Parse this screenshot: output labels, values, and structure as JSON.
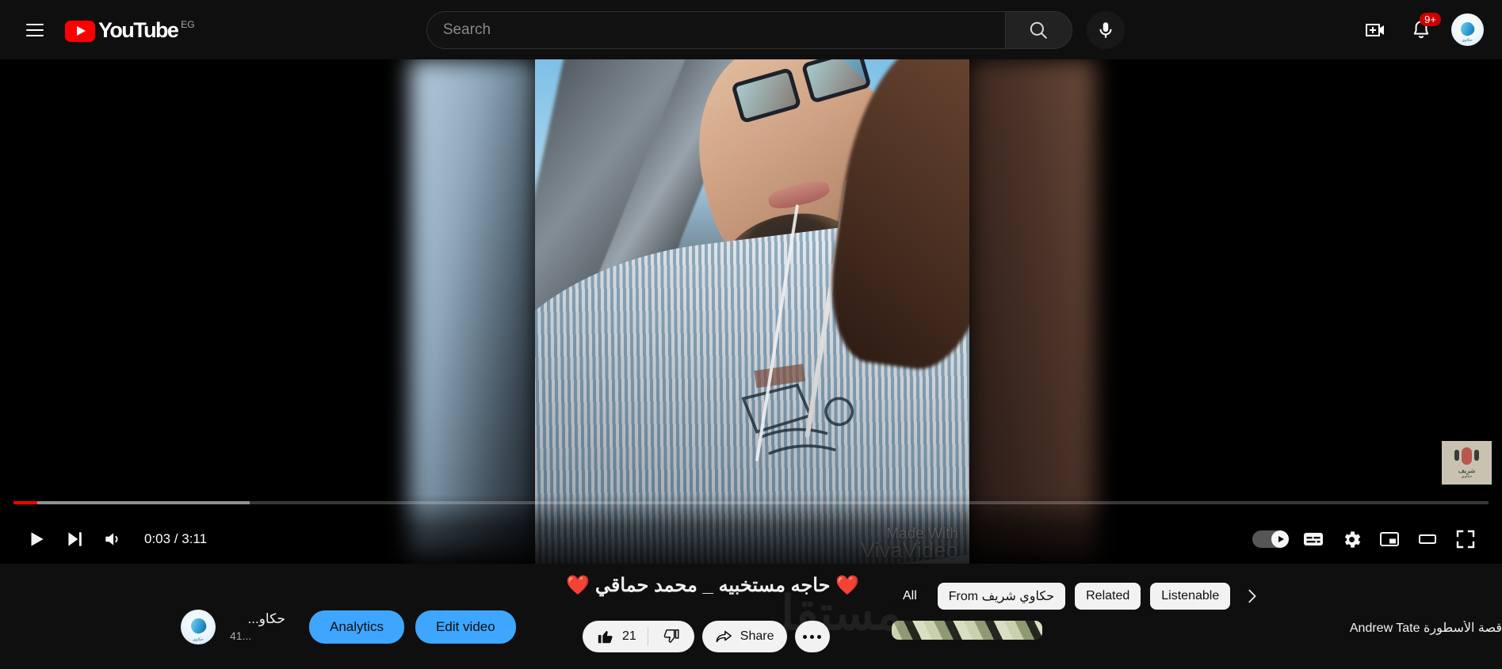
{
  "header": {
    "menu_icon": "hamburger-menu-icon",
    "logo_text": "YouTube",
    "country_code": "EG",
    "search": {
      "placeholder": "Search",
      "value": "",
      "search_icon": "search-icon",
      "mic_icon": "microphone-icon"
    },
    "create_icon": "create-video-icon",
    "notifications_icon": "notification-bell-icon",
    "notifications_badge": "9+",
    "avatar_icon": "account-avatar"
  },
  "player": {
    "current_time": "0:03",
    "duration": "3:11",
    "time_display": "0:03 / 3:11",
    "progress_percent": 1.6,
    "buffered_percent": 16.0,
    "play_icon": "play-icon",
    "next_icon": "next-video-icon",
    "volume_icon": "volume-icon",
    "autoplay_label": "autoplay-toggle",
    "subtitles_icon": "subtitles-icon",
    "settings_icon": "settings-gear-icon",
    "miniplayer_icon": "miniplayer-icon",
    "theater_icon": "theater-mode-icon",
    "fullscreen_icon": "fullscreen-icon",
    "video_watermark_line1": "Made With",
    "video_watermark_line2": "VivaVideo",
    "channel_watermark_line1": "شريف",
    "channel_watermark_line2": "حكاوي"
  },
  "video": {
    "title": "❤️ حاجه مستخبيه _ محمد حماقي ❤️",
    "channel_name": "حكاو...",
    "subscriber_count": "41...",
    "analytics_label": "Analytics",
    "edit_video_label": "Edit video",
    "like_count": "21",
    "like_icon": "thumbs-up-icon",
    "dislike_icon": "thumbs-down-icon",
    "share_label": "Share",
    "share_icon": "share-icon",
    "more_icon": "more-options-icon"
  },
  "watermark": {
    "text": "مستقل"
  },
  "right_rail": {
    "chips": [
      {
        "label": "All",
        "selected": true
      },
      {
        "label": "From حكاوي شريف",
        "selected": false
      },
      {
        "label": "Related",
        "selected": false
      },
      {
        "label": "Listenable",
        "selected": false
      }
    ],
    "next_chip_icon": "chevron-right-icon",
    "recommendations": [
      {
        "title": "قصة الأسطورة Andrew Tate"
      }
    ]
  },
  "colors": {
    "brand_red": "#ff0000",
    "accent_blue": "#3ea6ff",
    "background": "#0f0f0f",
    "badge_red": "#cc0000"
  }
}
